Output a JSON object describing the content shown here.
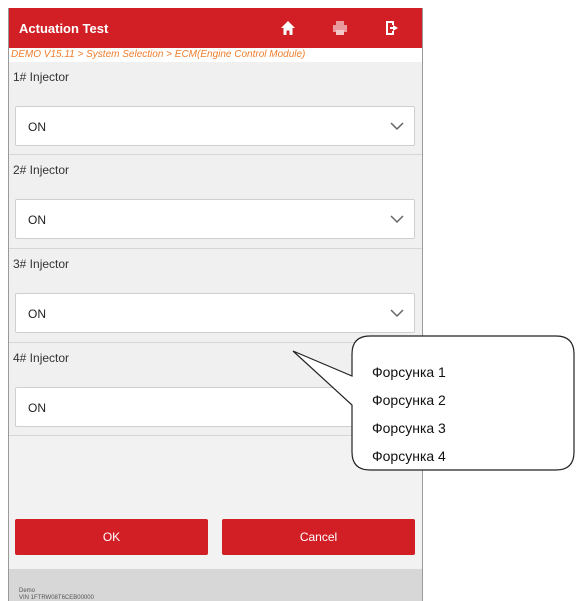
{
  "header": {
    "title": "Actuation Test",
    "icons": [
      "home-icon",
      "print-icon",
      "exit-icon"
    ]
  },
  "breadcrumb": "DEMO V15.11 > System Selection > ECM(Engine Control Module)",
  "injectors": [
    {
      "label": "1# Injector",
      "value": "ON"
    },
    {
      "label": "2# Injector",
      "value": "ON"
    },
    {
      "label": "3# Injector",
      "value": "ON"
    },
    {
      "label": "4# Injector",
      "value": "ON"
    }
  ],
  "buttons": {
    "ok": "OK",
    "cancel": "Cancel"
  },
  "footer": {
    "line1": "Demo",
    "line2": "VIN 1FTRW08T6CEB00000"
  },
  "callout": {
    "lines": [
      "Форсунка 1",
      "Форсунка 2",
      "Форсунка 3",
      "Форсунка 4"
    ]
  },
  "colors": {
    "accent": "#d21f26",
    "breadcrumb": "#f07d2c",
    "background": "#f2f2f2"
  }
}
